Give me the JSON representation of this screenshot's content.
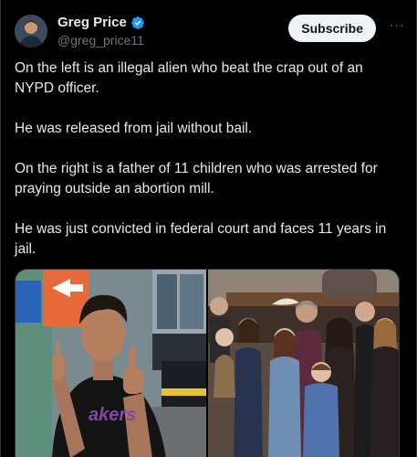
{
  "author": {
    "display_name": "Greg Price",
    "handle": "@greg_price11",
    "verified": true,
    "avatar_icon": "profile-photo"
  },
  "actions": {
    "subscribe_label": "Subscribe",
    "more_label": "···"
  },
  "tweet": {
    "paragraphs": [
      "On the left is an illegal alien who beat the crap out of an NYPD officer.",
      "He was released from jail without bail.",
      "On the right is a father of 11 children who was arrested for praying outside an abortion mill.",
      "He was just convicted in federal court and faces 11 years in jail."
    ]
  },
  "media": {
    "count": 2,
    "left_icon": "photo-man-gesturing",
    "right_icon": "photo-family-portrait",
    "shirt_text": "akers"
  },
  "colors": {
    "background": "#000000",
    "text": "#e7e9ea",
    "secondary_text": "#71767b",
    "verified_blue": "#1d9bf0",
    "button_bg": "#eff3f4",
    "border": "#2f3336"
  }
}
